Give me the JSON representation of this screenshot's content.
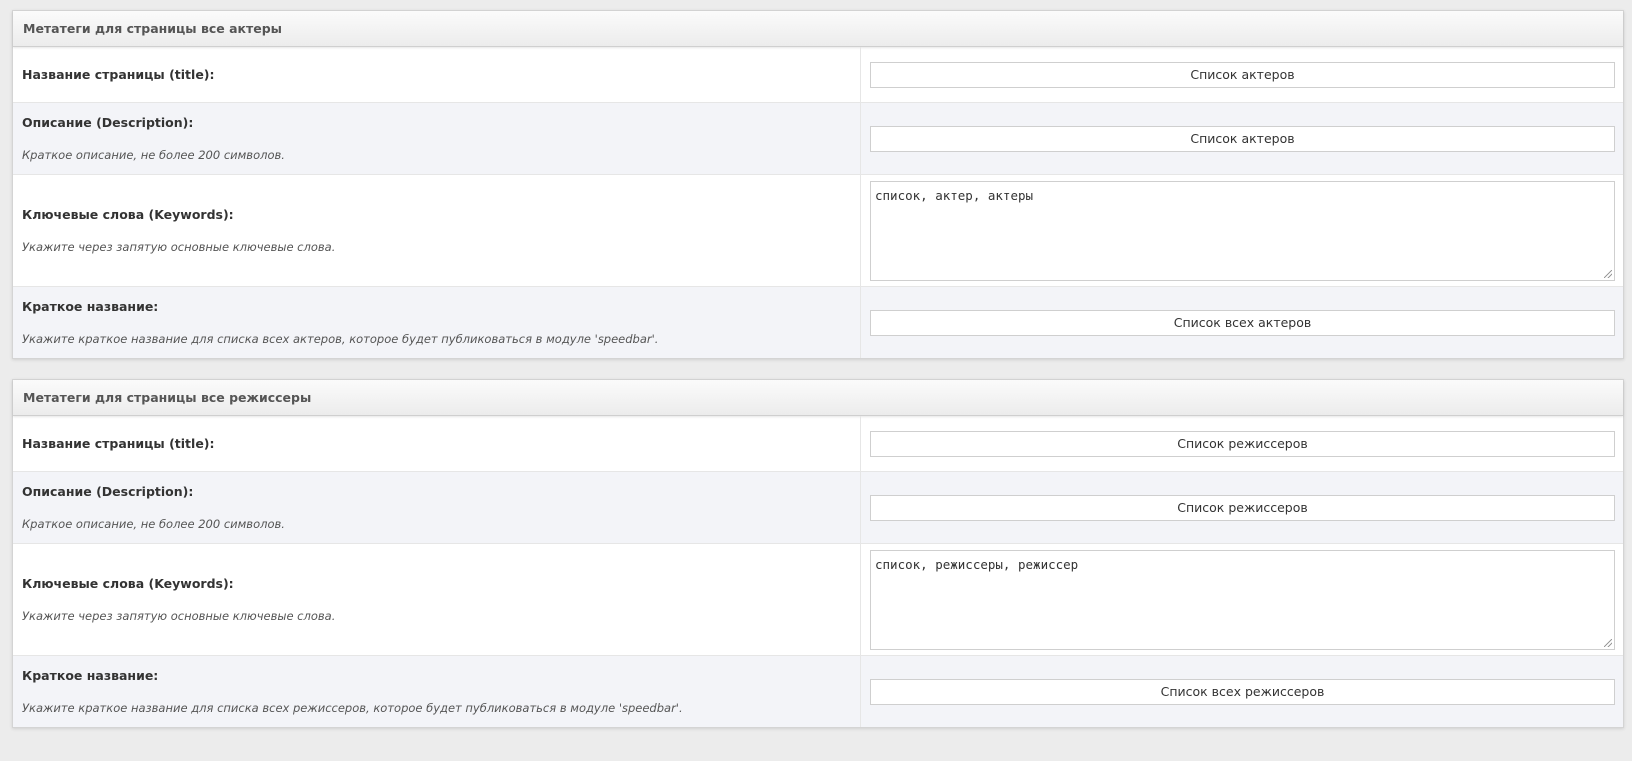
{
  "panels": [
    {
      "header": "Метатеги для страницы все актеры",
      "title_row": {
        "label": "Название страницы (title):",
        "value": "Список актеров"
      },
      "description_row": {
        "label": "Описание (Description):",
        "hint": "Краткое описание, не более 200 символов.",
        "value": "Список актеров"
      },
      "keywords_row": {
        "label": "Ключевые слова (Keywords):",
        "hint": "Укажите через запятую основные ключевые слова.",
        "value": "список, актер, актеры"
      },
      "short_name_row": {
        "label": "Краткое название:",
        "hint": "Укажите краткое название для списка всех актеров, которое будет публиковаться в модуле 'speedbar'.",
        "value": "Список всех актеров"
      }
    },
    {
      "header": "Метатеги для страницы все режиссеры",
      "title_row": {
        "label": "Название страницы (title):",
        "value": "Список режиссеров"
      },
      "description_row": {
        "label": "Описание (Description):",
        "hint": "Краткое описание, не более 200 символов.",
        "value": "Список режиссеров"
      },
      "keywords_row": {
        "label": "Ключевые слова (Keywords):",
        "hint": "Укажите через запятую основные ключевые слова.",
        "value": "список, режиссеры, режиссер"
      },
      "short_name_row": {
        "label": "Краткое название:",
        "hint": "Укажите краткое название для списка всех режиссеров, которое будет публиковаться в модуле 'speedbar'.",
        "value": "Список всех режиссеров"
      }
    }
  ]
}
